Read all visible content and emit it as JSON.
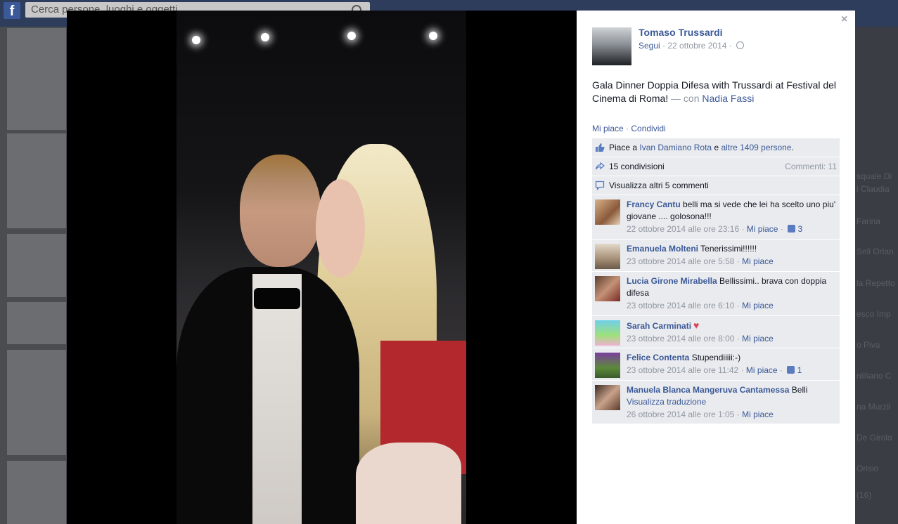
{
  "background": {
    "search_placeholder": "Cerca persone, luoghi e oggetti",
    "names": [
      "squale Di",
      "i Claudia",
      "Farina",
      "Seli Orlan",
      "la Repetto",
      "esco Imp",
      "o Piva",
      "nilliano C",
      "na Murzil",
      "De Girola",
      "Orisio",
      "(16)"
    ]
  },
  "panel": {
    "close_glyph": "×",
    "author": {
      "name": "Tomaso Trussardi",
      "follow": "Segui",
      "sep": " · ",
      "date": "22 ottobre 2014",
      "sep2": " · "
    },
    "caption": {
      "text": "Gala Dinner Doppia Difesa with Trussardi at Festival del Cinema di Roma!",
      "with_label": "— con",
      "tagged": "Nadia Fassi"
    },
    "actions": {
      "like": "Mi piace",
      "sep": " · ",
      "share": "Condividi"
    },
    "likes": {
      "prefix": "Piace a",
      "person": "Ivan Damiano Rota",
      "mid": " e ",
      "others": "altre 1409 persone",
      "end": "."
    },
    "shares": {
      "label": "15 condivisioni",
      "comments_count": "Commenti: 11"
    },
    "more_comments": "Visualizza altri 5 commenti",
    "comments": [
      {
        "author": "Francy Cantu",
        "text": "belli ma si vede che lei ha scelto uno piu' giovane .... golosona!!!",
        "time": "22 ottobre 2014 alle ore 23:16",
        "like": "Mi piace",
        "likes_count": "3"
      },
      {
        "author": "Emanuela Molteni",
        "text": "Tenerissimi!!!!!!",
        "time": "23 ottobre 2014 alle ore 5:58",
        "like": "Mi piace"
      },
      {
        "author": "Lucia Girone Mirabella",
        "text": "Bellissimi.. brava con doppia difesa",
        "time": "23 ottobre 2014 alle ore 6:10",
        "like": "Mi piace"
      },
      {
        "author": "Sarah Carminati",
        "text": "",
        "time": "23 ottobre 2014 alle ore 8:00",
        "like": "Mi piace"
      },
      {
        "author": "Felice Contenta",
        "text": "Stupendiiiii:-)",
        "time": "23 ottobre 2014 alle ore 11:42",
        "like": "Mi piace",
        "likes_count": "1"
      },
      {
        "author": "Manuela Blanca Mangeruva Cantamessa",
        "text": "Belli",
        "translate": "Visualizza traduzione",
        "time": "26 ottobre 2014 alle ore 1:05",
        "like": "Mi piace"
      }
    ],
    "meta_sep": " · "
  },
  "colors": {
    "link": "#3b5998",
    "muted": "#9197a3",
    "ufi_bg": "#e9ebee",
    "dress": "#b3282d"
  }
}
